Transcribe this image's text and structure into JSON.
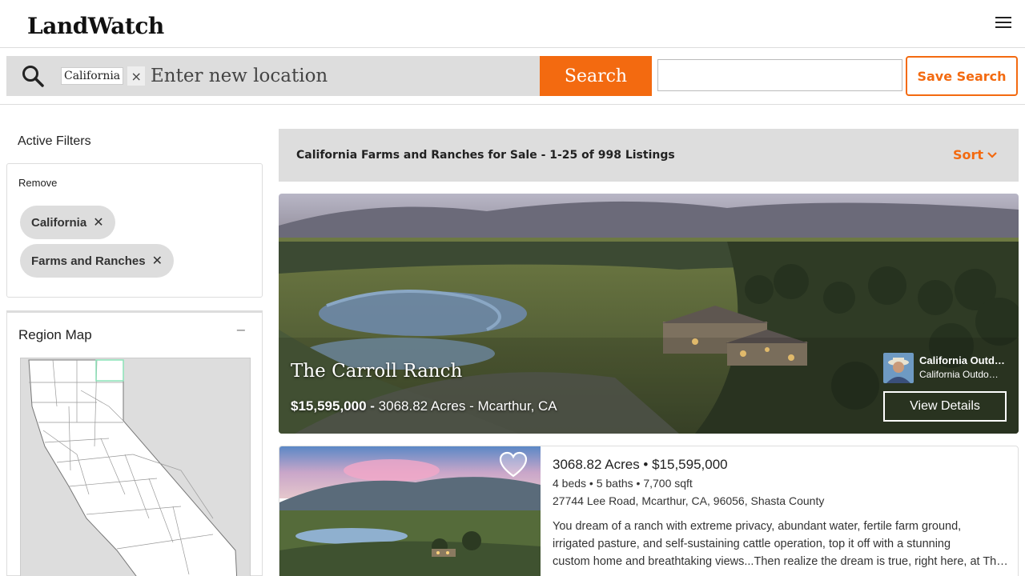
{
  "header": {
    "logo": "LandWatch",
    "menu_icon": "hamburger-menu-icon"
  },
  "search": {
    "location_chip": "California",
    "chip_remove": "×",
    "placeholder": "Enter new location",
    "button": "Search",
    "save_button": "Save Search",
    "accent_color": "#f36a10"
  },
  "sidebar": {
    "active_filters": "Active Filters",
    "remove": "Remove",
    "filters": [
      {
        "label": "California",
        "remove": "✕"
      },
      {
        "label": "Farms and Ranches",
        "remove": "✕"
      }
    ],
    "region_map": {
      "title": "Region Map",
      "collapse": "−"
    }
  },
  "results": {
    "title": "California Farms and Ranches for Sale - 1-25 of 998 Listings",
    "sort": "Sort"
  },
  "featured": {
    "name": "The Carroll Ranch",
    "price": "$15,595,000 -",
    "details": "3068.82 Acres  - Mcarthur, CA",
    "agent_name": "California Outdoor Properties",
    "agent_sub": "California Outdoor Properties",
    "view_details": "View Details"
  },
  "listing": {
    "title": "3068.82 Acres • $15,595,000",
    "specs": "4 beds • 5 baths • 7,700 sqft",
    "address": "27744 Lee Road, Mcarthur, CA, 96056, Shasta County",
    "desc_1": "You dream of a ranch with extreme privacy, abundant water, fertile farm ground,",
    "desc_2": "irrigated pasture, and self-sustaining cattle operation, top it off with a stunning",
    "desc_3": "custom home and breathtaking views...Then realize the dream is true, right here, at The Carroll Ranch."
  }
}
